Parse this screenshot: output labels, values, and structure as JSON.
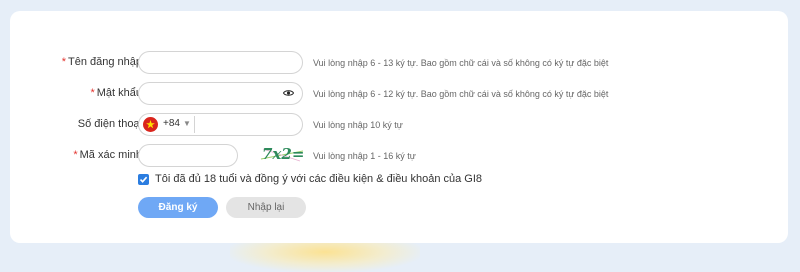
{
  "form": {
    "username": {
      "label": "Tên đăng nhập",
      "required": "*",
      "value": "",
      "hint": "Vui lòng nhập 6 - 13 ký tự. Bao gồm chữ cái và số không có ký tự đặc biệt"
    },
    "password": {
      "label": "Mật khẩu",
      "required": "*",
      "value": "",
      "icon": "eye-icon",
      "hint": "Vui lòng nhập 6 - 12 ký tự. Bao gồm chữ cái và số không có ký tự đặc biệt"
    },
    "phone": {
      "label": "Số điện thoại",
      "country_flag": "vietnam-flag-icon",
      "country_code": "+84",
      "caret": "▼",
      "value": "",
      "hint": "Vui lòng nhập 10 ký tự"
    },
    "captcha": {
      "label": "Mã xác minh",
      "required": "*",
      "value": "",
      "image_text": "7x2=?",
      "hint": "Vui lòng nhập 1 - 16 ký tự"
    },
    "agree": {
      "checked": true,
      "text": "Tôi đã đủ 18 tuổi và đồng ý với các điều kiện & điều khoản của GI8"
    },
    "buttons": {
      "register": "Đăng ký",
      "reset": "Nhập lại"
    }
  },
  "colors": {
    "accent": "#6fa8f5",
    "required": "#e3342f",
    "checkbox": "#2b7de0"
  }
}
